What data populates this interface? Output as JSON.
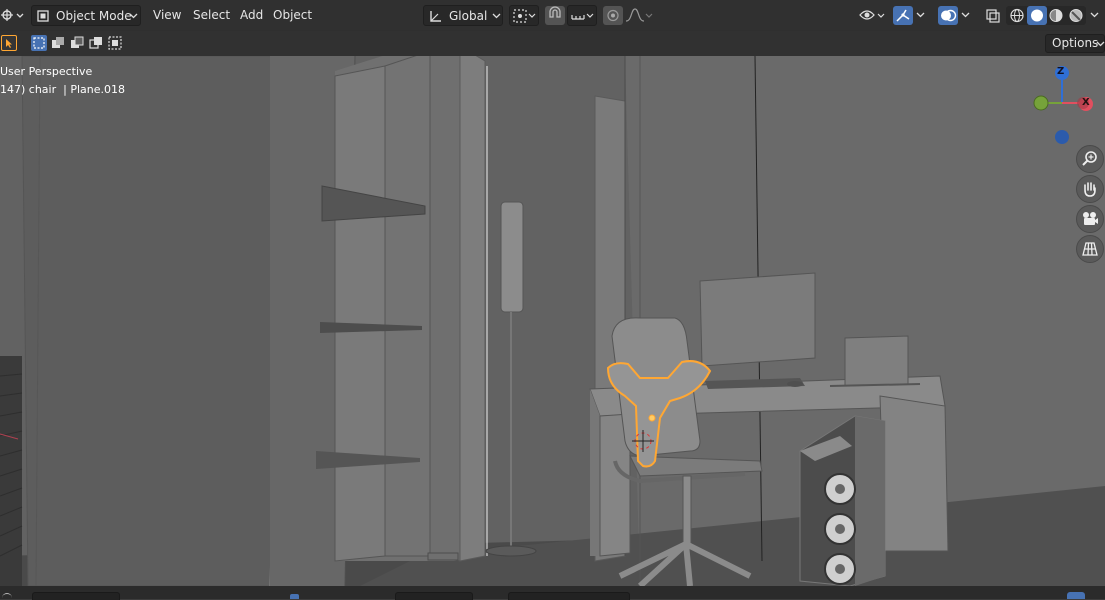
{
  "header": {
    "mode_label": "Object Mode",
    "menus": [
      "View",
      "Select",
      "Add",
      "Object"
    ],
    "transform_orientation": "Global"
  },
  "toolbar": {
    "options_label": "Options"
  },
  "viewport": {
    "view_name": "User Perspective",
    "object_info": "147) chair  | Plane.018",
    "gizmo": {
      "z": "Z",
      "x": "X"
    }
  },
  "colors": {
    "header_bg": "#303030",
    "accent_blue": "#4772b3",
    "selection_orange": "#ffa733",
    "axis_x": "#e14f5f",
    "axis_y": "#76a23a",
    "axis_z": "#2f6fd6",
    "viewport_bg": "#5e5e5e"
  },
  "icons": [
    "editor-type-icon",
    "object-mode-icon",
    "orientation-icon",
    "pivot-icon",
    "snap-magnet-icon",
    "snap-increment-icon",
    "proportional-edit-icon",
    "falloff-icon",
    "visibility-icon",
    "gizmo-icon",
    "overlay-icon",
    "xray-icon",
    "wireframe-shading-icon",
    "solid-shading-icon",
    "material-shading-icon",
    "rendered-shading-icon",
    "zoom-icon",
    "pan-hand-icon",
    "camera-view-icon",
    "ortho-grid-icon"
  ]
}
